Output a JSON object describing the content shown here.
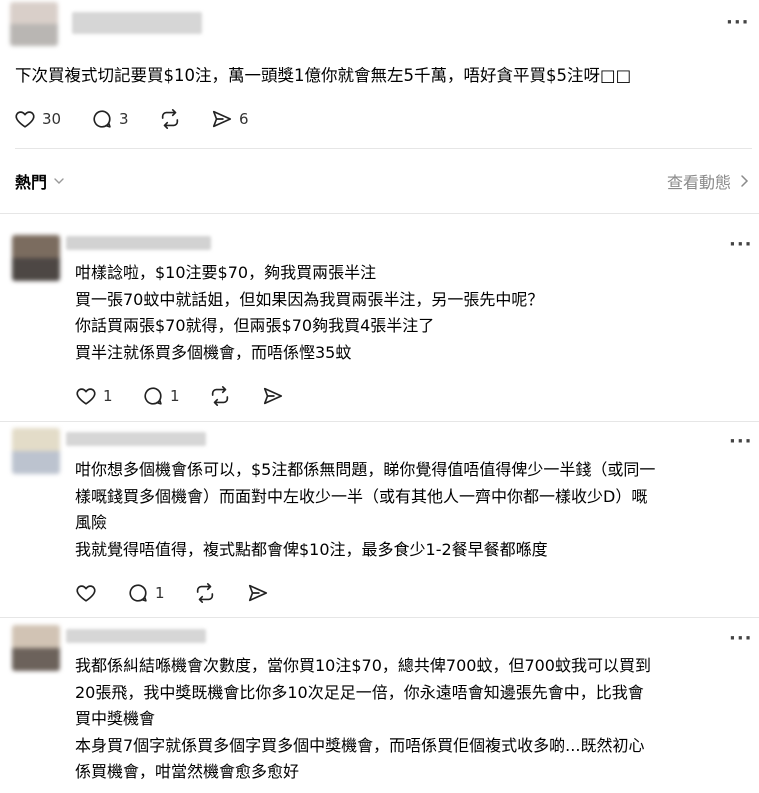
{
  "post": {
    "text": "下次買複式切記要買$10注，萬一頭獎1億你就會無左5千萬，唔好貪平買$5注呀□□",
    "likes": "30",
    "replies": "3",
    "reposts": "",
    "shares": "6"
  },
  "sort": {
    "label": "熱門"
  },
  "view_activity": {
    "label": "查看動態"
  },
  "comments": [
    {
      "lines": [
        "咁樣諗啦，$10注要$70，夠我買兩張半注",
        "買一張70蚊中就話姐，但如果因為我買兩張半注，另一張先中呢？",
        "你話買兩張$70就得，但兩張$70夠我買4張半注了",
        "買半注就係買多個機會，而唔係慳35蚊"
      ],
      "likes": "1",
      "replies": "1"
    },
    {
      "lines": [
        "咁你想多個機會係可以，$5注都係無問題，睇你覺得值唔值得俾少一半錢（或同一",
        "樣嘅錢買多個機會）而面對中左收少一半（或有其他人一齊中你都一樣收少D）嘅",
        "風險",
        "我就覺得唔值得，複式點都會俾$10注，最多食少1-2餐早餐都喺度"
      ],
      "likes": "",
      "replies": "1"
    },
    {
      "lines": [
        "我都係糾結喺機會次數度，當你買10注$70，總共俾700蚊，但700蚊我可以買到",
        "20張飛，我中獎既機會比你多10次足足一倍，你永遠唔會知邊張先會中，比我會",
        "買中獎機會",
        "本身買7個字就係買多個字買多個中獎機會，而唔係買佢個複式收多啲...既然初心",
        "係買機會，咁當然機會愈多愈好"
      ]
    }
  ],
  "more_glyph": "···"
}
